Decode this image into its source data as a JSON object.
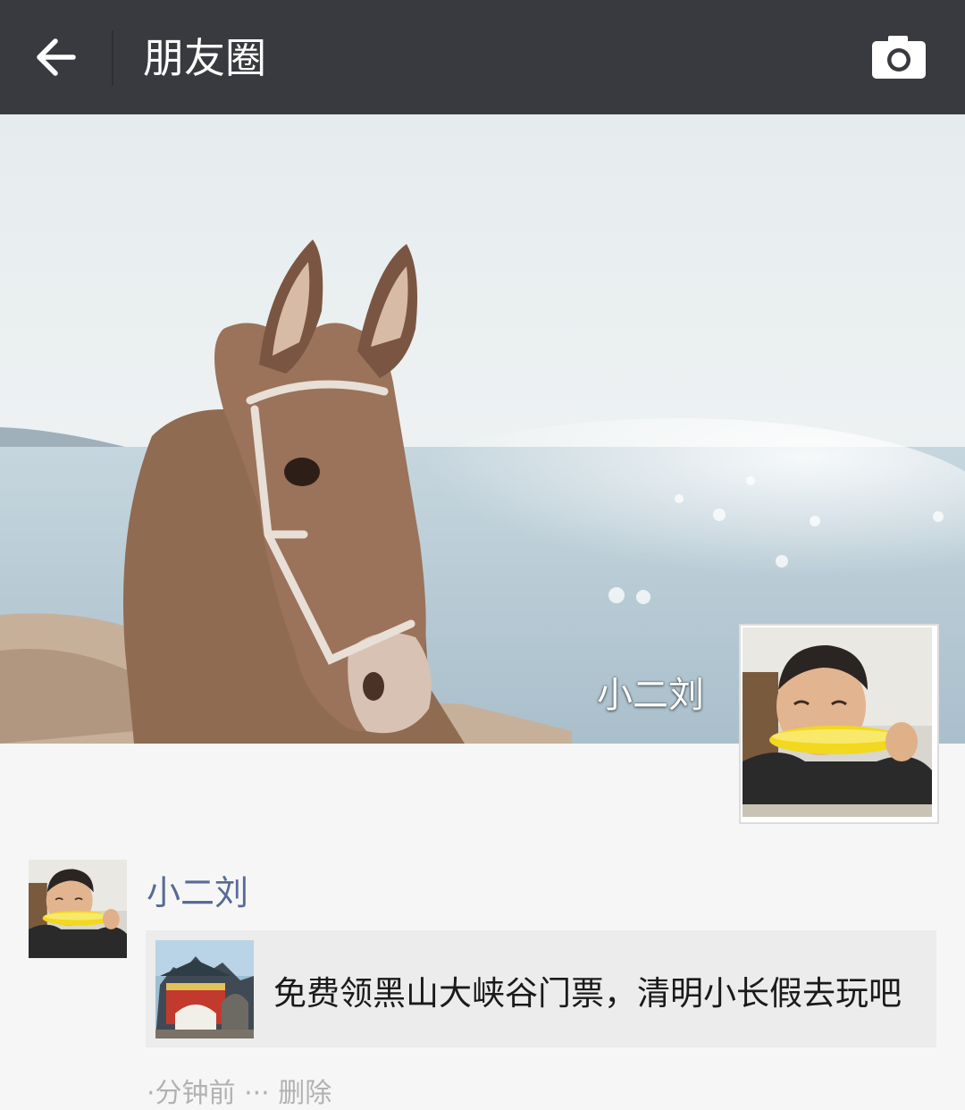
{
  "topbar": {
    "title": "朋友圈",
    "back_icon": "arrow-left-icon",
    "camera_icon": "camera-icon"
  },
  "profile": {
    "name": "小二刘",
    "cover_photo": "donkey-by-sea-photo",
    "avatar_photo": "child-eating-corn-photo"
  },
  "post": {
    "author": "小二刘",
    "avatar_photo": "child-eating-corn-photo",
    "share": {
      "thumbnail": "temple-gate-photo",
      "text": "免费领黑山大峡谷门票，清明小长假去玩吧"
    },
    "cut_off_text": "·分钟前 ··· 删除"
  },
  "colors": {
    "topbar_bg": "#393a3f",
    "name_link": "#576b95",
    "page_bg": "#f6f6f6",
    "share_card_bg": "#ececec"
  }
}
